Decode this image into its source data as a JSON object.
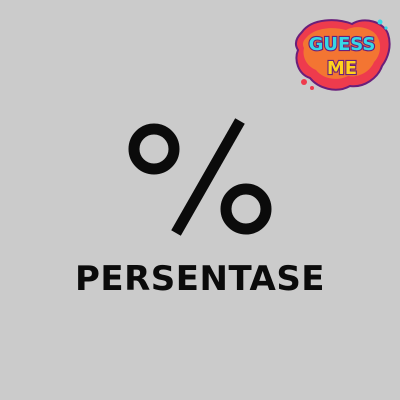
{
  "logo": {
    "line1": "GUESS",
    "line2": "ME"
  },
  "card": {
    "symbol": "%",
    "word": "PERSENTASE"
  },
  "colors": {
    "background": "#cbcbcb",
    "text": "#0b0b0b",
    "logo_blob_red": "#ee3b4d",
    "logo_blob_orange": "#f7a51e",
    "logo_text_cyan": "#36d8e6",
    "logo_text_yellow": "#ffd21e",
    "logo_outline": "#6a1f7a"
  }
}
